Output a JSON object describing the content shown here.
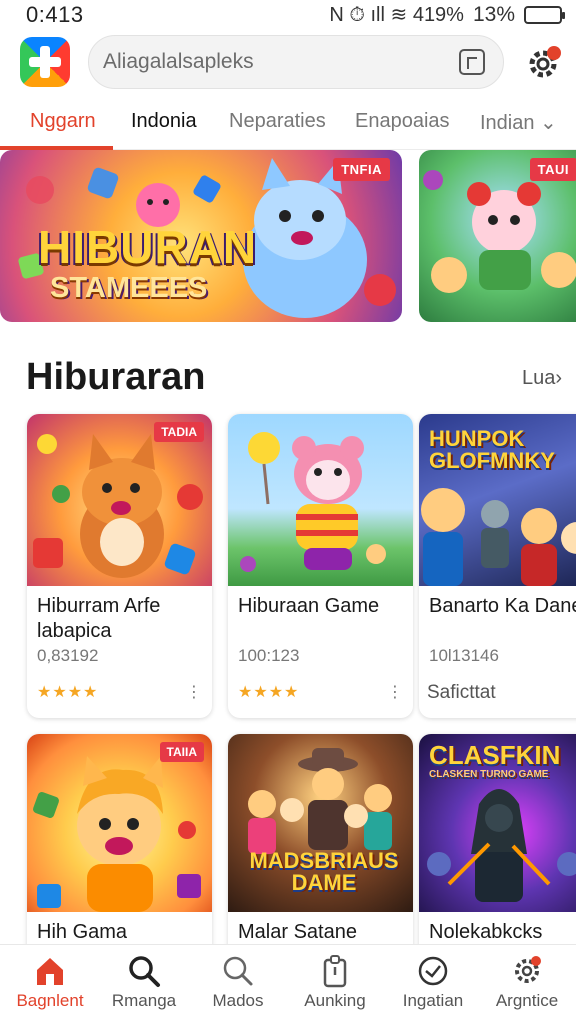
{
  "status_bar": {
    "time": "0:413",
    "indicators": "N ⏱ ıll ≋ 419%",
    "battery_text": "13%"
  },
  "header": {
    "search_placeholder": "Aliagalalsapleks",
    "logo_icon": "app-plus-logo-icon",
    "scan_icon": "scan-icon",
    "settings_icon": "gear-notification-icon"
  },
  "tabs": [
    {
      "label": "Nggarn",
      "state": "active"
    },
    {
      "label": "Indonia",
      "state": "bold"
    },
    {
      "label": "Neparaties",
      "state": "normal"
    },
    {
      "label": "Enapoaias",
      "state": "normal"
    },
    {
      "label": "Indian ⌄",
      "state": "normal"
    }
  ],
  "banners": [
    {
      "badge": "TNFIA",
      "title": "HIBURAN",
      "subtitle": "STAMEEES"
    },
    {
      "badge": "TAUI"
    }
  ],
  "section": {
    "title": "Hiburaran",
    "see_more": "Lua›"
  },
  "cards": [
    {
      "badge": "TADIA",
      "title": "Hiburram Arfe labapica",
      "sub": "0,83192",
      "stars": "★★★★",
      "more": "⋮"
    },
    {
      "title": "Hiburaan Game",
      "sub": "100:123",
      "stars": "★★★★",
      "more": "⋮"
    },
    {
      "thumb_title": "HUNPOK GLOFMNKY",
      "title": "Banarto Ka Dane",
      "sub": "10l13146",
      "meta": "Saficttat"
    },
    {
      "badge": "TAIIA",
      "title": "Hih Gama"
    },
    {
      "thumb_title": "MADSBRIAUS DAME",
      "title": "Malar Satane"
    },
    {
      "thumb_title": "CLASFKIN",
      "thumb_sub": "CLASKEN TURNO GAME",
      "title": "Nolekabkcks"
    }
  ],
  "bottom_nav": [
    {
      "label": "Bagnlent",
      "icon": "home-icon",
      "active": true
    },
    {
      "label": "Rmanga",
      "icon": "search-icon",
      "active": false
    },
    {
      "label": "Mados",
      "icon": "search-icon",
      "active": false
    },
    {
      "label": "Aunking",
      "icon": "clipboard-icon",
      "active": false
    },
    {
      "label": "Ingatian",
      "icon": "check-circle-icon",
      "active": false
    },
    {
      "label": "Argntice",
      "icon": "gear-icon",
      "active": false
    }
  ],
  "colors": {
    "accent": "#e2422b",
    "star": "#f5a623",
    "badge": "#e63946"
  }
}
